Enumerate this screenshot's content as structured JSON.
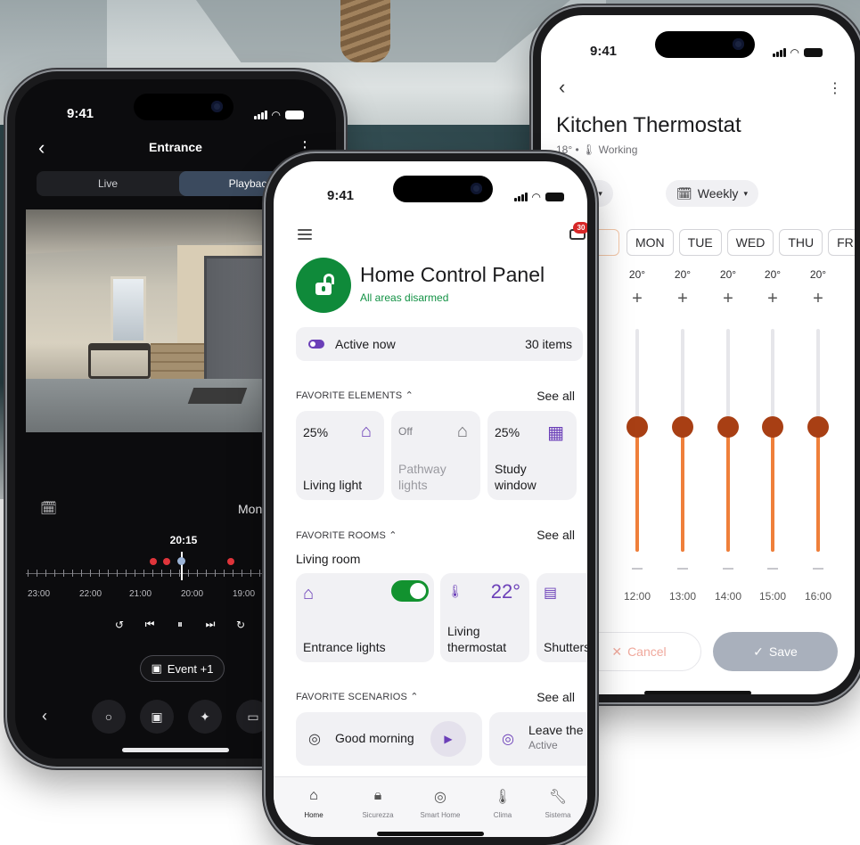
{
  "status_time": "9:41",
  "camera": {
    "title": "Entrance",
    "segments": [
      "Live",
      "Playback"
    ],
    "active_segment": "Playback",
    "date_label": "Monda",
    "timeline_time": "20:15",
    "timeline_labels": [
      "23:00",
      "22:00",
      "21:00",
      "20:00",
      "19:00"
    ],
    "playback_buttons": [
      "replay-10",
      "previous",
      "pause",
      "next",
      "forward-10"
    ],
    "event_button": "Event +1",
    "bottom_buttons": [
      "record",
      "snapshot",
      "ptz-control",
      "fullscreen"
    ]
  },
  "thermostat": {
    "title": "Kitchen Thermostat",
    "subtitle": "18° • 🌡 Working",
    "mode_chip": "ter",
    "schedule_chip": "Weekly",
    "days": [
      "MON",
      "TUE",
      "WED",
      "THU",
      "FR"
    ],
    "setpoints": [
      "20°",
      "20°",
      "20°",
      "20°",
      "20°"
    ],
    "slider_level_pct": [
      56,
      56,
      56,
      56,
      56
    ],
    "hours": [
      "12:00",
      "13:00",
      "14:00",
      "15:00",
      "16:00"
    ],
    "cancel_label": "Cancel",
    "save_label": "Save",
    "accent": "#ef7f3a"
  },
  "panel": {
    "inbox_badge": "30",
    "title": "Home Control Panel",
    "status": "All areas disarmed",
    "active_label": "Active now",
    "active_count": "30 items",
    "favorite_elements": {
      "heading": "FAVORITE ELEMENTS",
      "see_all": "See all",
      "items": [
        {
          "value": "25%",
          "name": "Living light",
          "icon": "ceiling-lamp-icon"
        },
        {
          "value": "Off",
          "name": "Pathway lights",
          "icon": "ceiling-lamp-icon"
        },
        {
          "value": "25%",
          "name": "Study window",
          "icon": "window-icon"
        }
      ]
    },
    "favorite_rooms": {
      "heading": "FAVORITE ROOMS",
      "see_all": "See all",
      "room": "Living room",
      "items": [
        {
          "name": "Entrance lights",
          "state": "on"
        },
        {
          "name": "Living thermostat",
          "value": "22°"
        },
        {
          "name": "Shutters"
        }
      ]
    },
    "favorite_scenarios": {
      "heading": "FAVORITE SCENARIOS",
      "see_all": "See all",
      "items": [
        {
          "name": "Good morning"
        },
        {
          "name": "Leave the h",
          "status": "Active"
        }
      ]
    },
    "tabs": [
      "Home",
      "Sicurezza",
      "Smart Home",
      "Clima",
      "Sistema"
    ],
    "active_tab": "Home",
    "accent": "#6b3fb8",
    "success": "#0f8a3a"
  }
}
